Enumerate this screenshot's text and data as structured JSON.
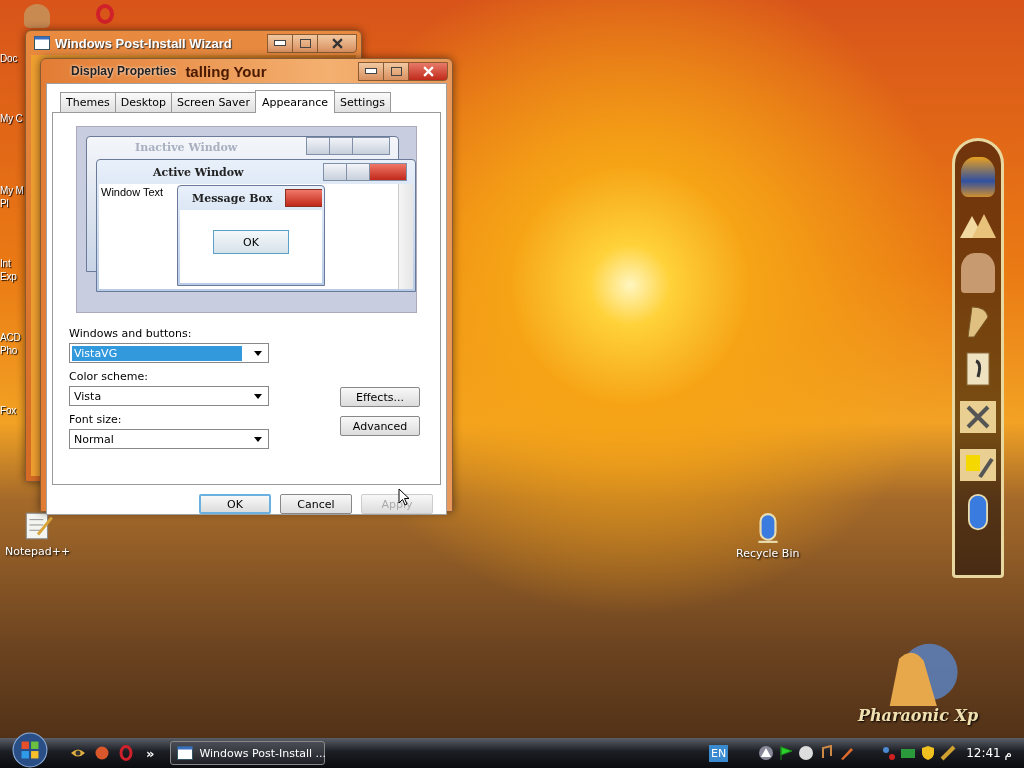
{
  "desktop_icons": [
    {
      "lines": [
        "Doc"
      ]
    },
    {
      "lines": [
        "My C"
      ]
    },
    {
      "lines": [
        "My M",
        "Pl"
      ]
    },
    {
      "lines": [
        "Int",
        "Exp"
      ]
    },
    {
      "lines": [
        "ACD",
        "Pho"
      ]
    },
    {
      "lines": [
        "Fox"
      ]
    }
  ],
  "shortcuts": [
    {
      "label": "Notepad++",
      "kind": "notepad"
    },
    {
      "label": "Recycle Bin",
      "kind": "bin"
    }
  ],
  "wizard": {
    "title": "Windows Post-Install Wizard",
    "heading": "talling Your"
  },
  "display_properties": {
    "title": "Display Properties",
    "tabs": [
      {
        "label": "Themes",
        "selected": false
      },
      {
        "label": "Desktop",
        "selected": false
      },
      {
        "label": "Screen Saver",
        "selected": false
      },
      {
        "label": "Appearance",
        "selected": true
      },
      {
        "label": "Settings",
        "selected": false
      }
    ],
    "preview": {
      "inactive_title": "Inactive Window",
      "active_title": "Active Window",
      "window_text": "Window Text",
      "message_title": "Message Box",
      "message_button": "OK"
    },
    "fields": [
      {
        "label": "Windows and buttons:",
        "value": "VistaVG",
        "selected": true
      },
      {
        "label": "Color scheme:",
        "value": "Vista",
        "selected": false
      },
      {
        "label": "Font size:",
        "value": "Normal",
        "selected": false
      }
    ],
    "side_buttons": [
      "Effects...",
      "Advanced"
    ],
    "buttons": [
      {
        "label": "OK",
        "default": true,
        "disabled": false
      },
      {
        "label": "Cancel",
        "default": false,
        "disabled": false
      },
      {
        "label": "Apply",
        "default": false,
        "disabled": true
      }
    ]
  },
  "logo": {
    "text": "Pharaonic Xp"
  },
  "taskbar": {
    "chevron": "»",
    "task": "Windows Post-Install ...",
    "language": "EN",
    "clock": "12:41 م"
  }
}
